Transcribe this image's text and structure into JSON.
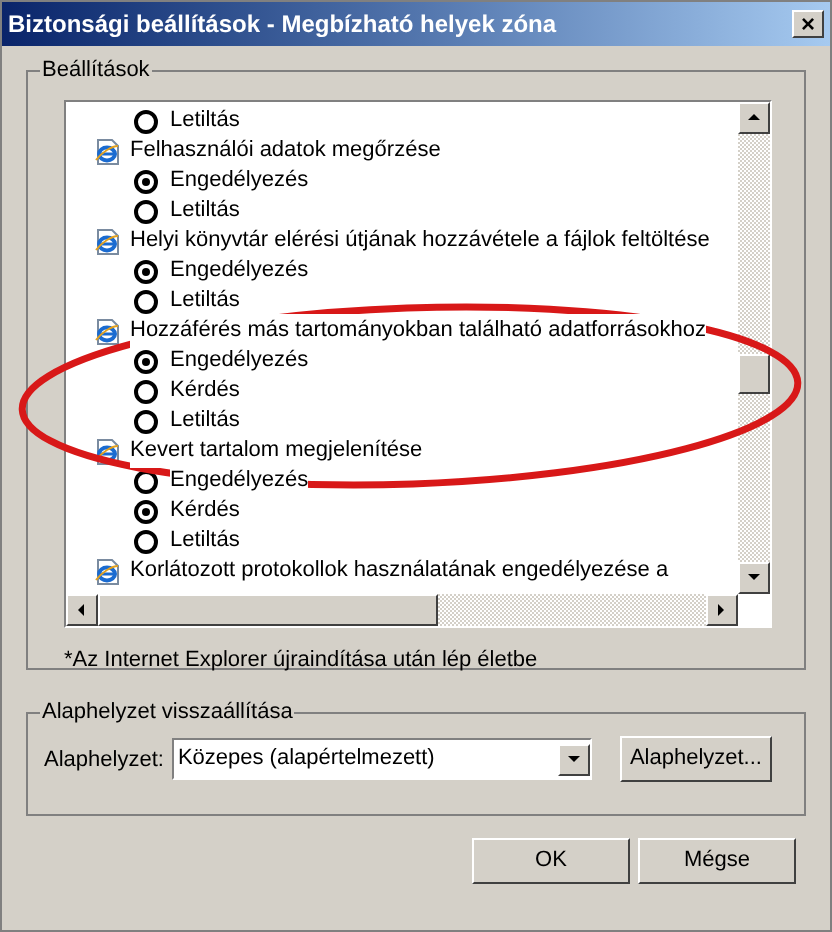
{
  "window": {
    "title": "Biztonsági beállítások - Megbízható helyek zóna",
    "close": "×"
  },
  "settings_group": {
    "title": "Beállítások",
    "settings": [
      {
        "options": [
          {
            "label": "Letiltás",
            "selected": false
          }
        ]
      },
      {
        "label": "Felhasználói adatok megőrzése",
        "options": [
          {
            "label": "Engedélyezés",
            "selected": true
          },
          {
            "label": "Letiltás",
            "selected": false
          }
        ]
      },
      {
        "label": "Helyi könyvtár elérési útjának hozzávétele a fájlok feltöltése",
        "options": [
          {
            "label": "Engedélyezés",
            "selected": true
          },
          {
            "label": "Letiltás",
            "selected": false
          }
        ]
      },
      {
        "label": "Hozzáférés más tartományokban található adatforrásokhoz",
        "options": [
          {
            "label": "Engedélyezés",
            "selected": true
          },
          {
            "label": "Kérdés",
            "selected": false
          },
          {
            "label": "Letiltás",
            "selected": false
          }
        ]
      },
      {
        "label": "Kevert tartalom megjelenítése",
        "options": [
          {
            "label": "Engedélyezés",
            "selected": false
          },
          {
            "label": "Kérdés",
            "selected": true
          },
          {
            "label": "Letiltás",
            "selected": false
          }
        ]
      },
      {
        "label": "Korlátozott protokollok használatának engedélyezése a"
      }
    ],
    "note": "*Az Internet Explorer újraindítása után lép életbe"
  },
  "reset_group": {
    "title": "Alaphelyzet visszaállítása",
    "label": "Alaphelyzet:",
    "value": "Közepes (alapértelmezett)",
    "button": "Alaphelyzet..."
  },
  "buttons": [
    "OK",
    "Mégse"
  ]
}
